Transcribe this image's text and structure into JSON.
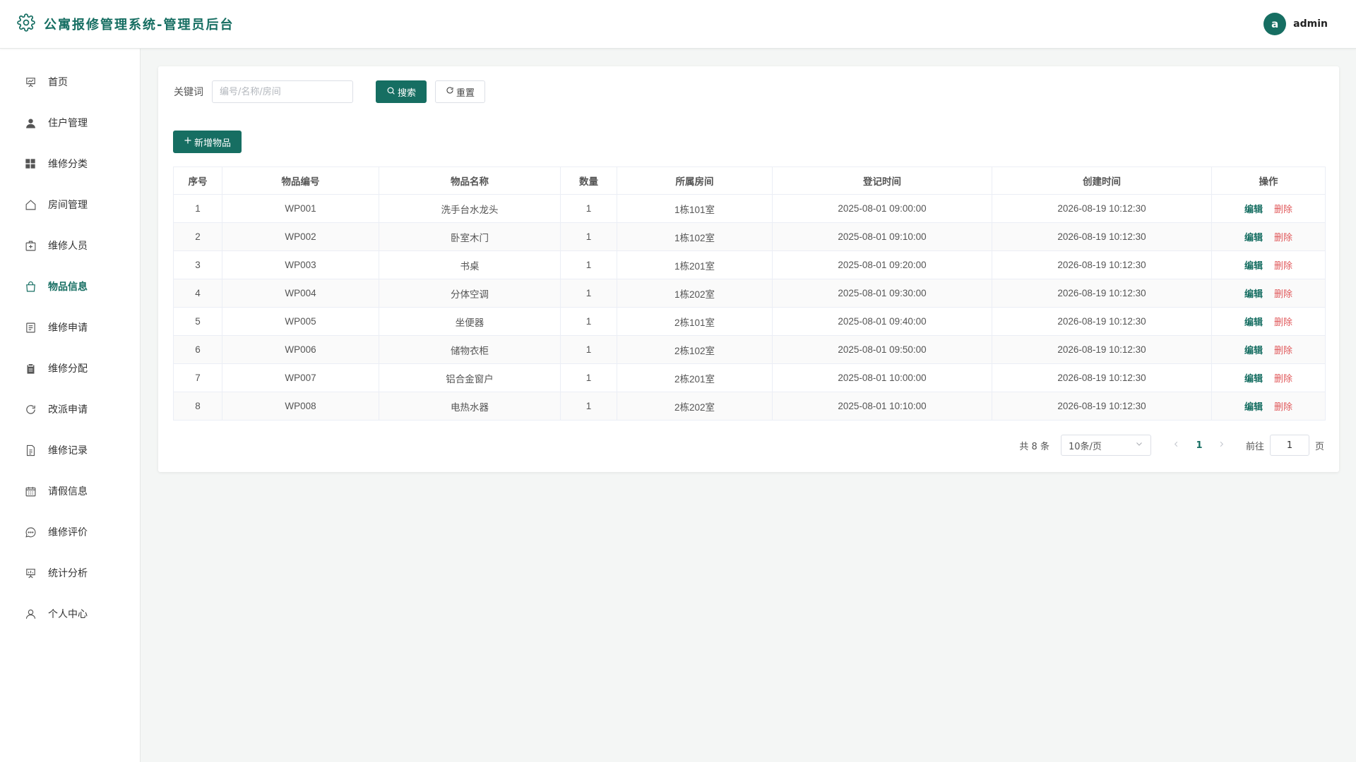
{
  "header": {
    "title": "公寓报修管理系统-管理员后台",
    "avatar_letter": "a",
    "username": "admin"
  },
  "sidebar": {
    "items": [
      {
        "label": "首页",
        "icon": "dashboard-icon",
        "active": false
      },
      {
        "label": "住户管理",
        "icon": "user-icon",
        "active": false
      },
      {
        "label": "维修分类",
        "icon": "grid-icon",
        "active": false
      },
      {
        "label": "房间管理",
        "icon": "house-icon",
        "active": false
      },
      {
        "label": "维修人员",
        "icon": "medical-box-icon",
        "active": false
      },
      {
        "label": "物品信息",
        "icon": "shopping-bag-icon",
        "active": true
      },
      {
        "label": "维修申请",
        "icon": "document-icon",
        "active": false
      },
      {
        "label": "维修分配",
        "icon": "clipboard-icon",
        "active": false
      },
      {
        "label": "改派申请",
        "icon": "refresh-icon",
        "active": false
      },
      {
        "label": "维修记录",
        "icon": "file-icon",
        "active": false
      },
      {
        "label": "请假信息",
        "icon": "calendar-icon",
        "active": false
      },
      {
        "label": "维修评价",
        "icon": "chat-icon",
        "active": false
      },
      {
        "label": "统计分析",
        "icon": "presentation-icon",
        "active": false
      },
      {
        "label": "个人中心",
        "icon": "person-icon",
        "active": false
      }
    ]
  },
  "search": {
    "label": "关键词",
    "placeholder": "编号/名称/房间",
    "value": "",
    "search_label": "搜索",
    "reset_label": "重置"
  },
  "actions": {
    "add_label": "新增物品"
  },
  "table": {
    "columns": [
      "序号",
      "物品编号",
      "物品名称",
      "数量",
      "所属房间",
      "登记时间",
      "创建时间",
      "操作"
    ],
    "edit_label": "编辑",
    "delete_label": "删除",
    "rows": [
      [
        "1",
        "WP001",
        "洗手台水龙头",
        "1",
        "1栋101室",
        "2025-08-01 09:00:00",
        "2026-08-19 10:12:30"
      ],
      [
        "2",
        "WP002",
        "卧室木门",
        "1",
        "1栋102室",
        "2025-08-01 09:10:00",
        "2026-08-19 10:12:30"
      ],
      [
        "3",
        "WP003",
        "书桌",
        "1",
        "1栋201室",
        "2025-08-01 09:20:00",
        "2026-08-19 10:12:30"
      ],
      [
        "4",
        "WP004",
        "分体空调",
        "1",
        "1栋202室",
        "2025-08-01 09:30:00",
        "2026-08-19 10:12:30"
      ],
      [
        "5",
        "WP005",
        "坐便器",
        "1",
        "2栋101室",
        "2025-08-01 09:40:00",
        "2026-08-19 10:12:30"
      ],
      [
        "6",
        "WP006",
        "储物衣柜",
        "1",
        "2栋102室",
        "2025-08-01 09:50:00",
        "2026-08-19 10:12:30"
      ],
      [
        "7",
        "WP007",
        "铝合金窗户",
        "1",
        "2栋201室",
        "2025-08-01 10:00:00",
        "2026-08-19 10:12:30"
      ],
      [
        "8",
        "WP008",
        "电热水器",
        "1",
        "2栋202室",
        "2025-08-01 10:10:00",
        "2026-08-19 10:12:30"
      ]
    ]
  },
  "pagination": {
    "total_text": "共 8 条",
    "page_size": "10条/页",
    "current_page": "1",
    "goto_label": "前往",
    "goto_value": "1",
    "page_suffix": "页"
  },
  "colors": {
    "primary": "#166e62",
    "danger": "#e0585a",
    "background": "#f4f6f5"
  }
}
